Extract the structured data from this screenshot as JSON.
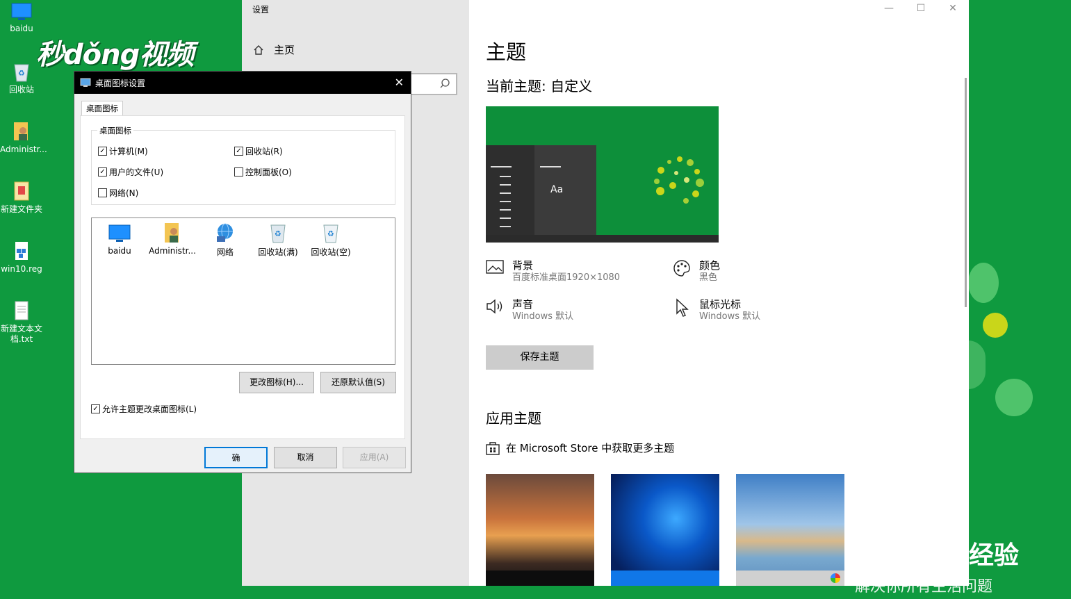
{
  "desktop": {
    "icons": [
      {
        "label": "baidu",
        "icon": "monitor-icon"
      },
      {
        "label": "回收站",
        "icon": "recycle-bin-icon"
      },
      {
        "label": "Administr...",
        "icon": "user-folder-icon"
      },
      {
        "label": "新建文件夹",
        "icon": "folder-icon"
      },
      {
        "label": "win10.reg",
        "icon": "registry-icon"
      },
      {
        "label": "新建文本文档.txt",
        "icon": "text-file-icon"
      }
    ],
    "watermark": "秒dǒng视频",
    "corner_watermark": "经验",
    "corner_caption": "解决你所有生活问题"
  },
  "settings": {
    "window_title": "设置",
    "home_label": "主页",
    "search_placeholder": "",
    "page_title": "主题",
    "current_theme": "当前主题: 自定义",
    "preview_label": "Aa",
    "props": {
      "background": {
        "label": "背景",
        "value": "百度标准桌面1920×1080"
      },
      "color": {
        "label": "颜色",
        "value": "黑色"
      },
      "sound": {
        "label": "声音",
        "value": "Windows 默认"
      },
      "cursor": {
        "label": "鼠标光标",
        "value": "Windows 默认"
      }
    },
    "save_button": "保存主题",
    "apply_title": "应用主题",
    "store_link": "在 Microsoft Store 中获取更多主题",
    "accent_color": "#0d8f3a"
  },
  "dialog": {
    "title": "桌面图标设置",
    "tab": "桌面图标",
    "group_title": "桌面图标",
    "checkboxes": {
      "computer": {
        "label": "计算机(M)",
        "checked": true
      },
      "recycle": {
        "label": "回收站(R)",
        "checked": true
      },
      "userfiles": {
        "label": "用户的文件(U)",
        "checked": true
      },
      "controlpanel": {
        "label": "控制面板(O)",
        "checked": false
      },
      "network": {
        "label": "网络(N)",
        "checked": false
      }
    },
    "list_icons": [
      {
        "label": "baidu",
        "icon": "monitor-icon"
      },
      {
        "label": "Administr...",
        "icon": "user-folder-icon"
      },
      {
        "label": "网络",
        "icon": "network-icon"
      },
      {
        "label": "回收站(满)",
        "icon": "recycle-bin-full-icon"
      },
      {
        "label": "回收站(空)",
        "icon": "recycle-bin-empty-icon"
      }
    ],
    "change_icon": "更改图标(H)...",
    "restore_default": "还原默认值(S)",
    "allow_theme": {
      "label": "允许主题更改桌面图标(L)",
      "checked": true
    },
    "ok": "确",
    "cancel": "取消",
    "apply": "应用(A)"
  }
}
